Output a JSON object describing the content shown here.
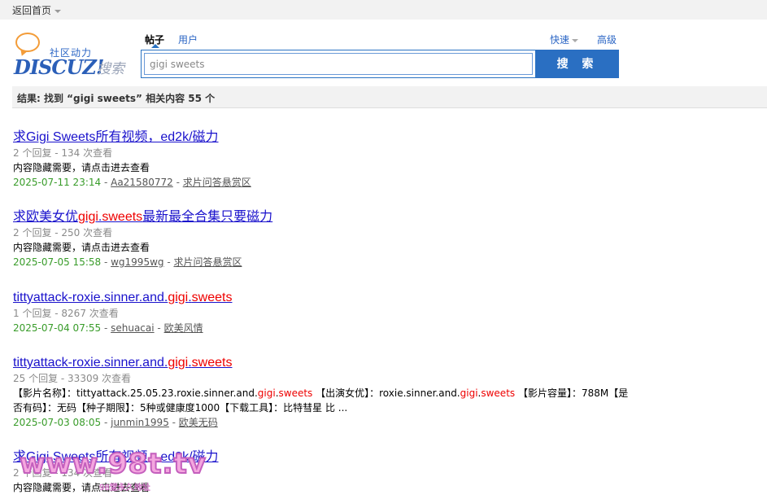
{
  "topbar": {
    "back_label": "返回首页"
  },
  "logo": {
    "slogan": "社区动力",
    "brand": "DISCUZ!",
    "suffix": "搜索"
  },
  "tabs": {
    "active": "帖子",
    "user": "用户"
  },
  "search": {
    "value": "gigi sweets",
    "button": "搜 索",
    "quick": "快速",
    "advanced": "高级"
  },
  "result_summary": "结果: 找到 “gigi sweets” 相关内容 55 个",
  "results": [
    {
      "title_parts": [
        "求Gigi Sweets所有视频，ed2k/磁力"
      ],
      "meta": "2 个回复 - 134 次查看",
      "excerpt_parts": [
        "内容隐藏需要，请点击进去查看"
      ],
      "date": "2025-07-11 23:14",
      "author": "Aa21580772",
      "forum": "求片问答悬赏区"
    },
    {
      "title_parts": [
        "求欧美女优",
        "gigi",
        ".",
        "sweets",
        "最新最全合集只要磁力"
      ],
      "meta": "2 个回复 - 250 次查看",
      "excerpt_parts": [
        "内容隐藏需要，请点击进去查看"
      ],
      "date": "2025-07-05 15:58",
      "author": "wg1995wg",
      "forum": "求片问答悬赏区"
    },
    {
      "title_parts": [
        "tittyattack-roxie.sinner.and.",
        "gigi",
        ".",
        "sweets"
      ],
      "meta": "1 个回复 - 8267 次查看",
      "excerpt_parts": [],
      "date": "2025-07-04 07:55",
      "author": "sehuacai",
      "forum": "欧美风情"
    },
    {
      "title_parts": [
        "tittyattack-roxie.sinner.and.",
        "gigi",
        ".",
        "sweets"
      ],
      "meta": "25 个回复 - 33309 次查看",
      "excerpt_parts": [
        "【影片名称】：tittyattack.25.05.23.roxie.sinner.and.",
        "gigi",
        ".",
        "sweets",
        " 【出演女优】：roxie.sinner.and.",
        "gigi",
        ".",
        "sweets",
        " 【影片容量】：788M【是否有码】：无码【种子期限】：5种或健康度1000【下载工具】：比特彗星 比 ..."
      ],
      "date": "2025-07-03 08:05",
      "author": "junmin1995",
      "forum": "欧美无码"
    },
    {
      "title_parts": [
        "求Gigi Sweets所有视频，ed2k/磁力"
      ],
      "meta": "2 个回复 - 134 次查看",
      "excerpt_parts": [
        "内容隐藏需要，请点击进去查看"
      ],
      "date": "",
      "author": "",
      "forum": ""
    }
  ],
  "watermark": {
    "main": "www.98t.tv",
    "sub": "98堂永久地址"
  },
  "colors": {
    "link": "#1a12cc",
    "highlight": "#e00000",
    "date": "#399c2a",
    "accent": "#2a6fc2"
  }
}
